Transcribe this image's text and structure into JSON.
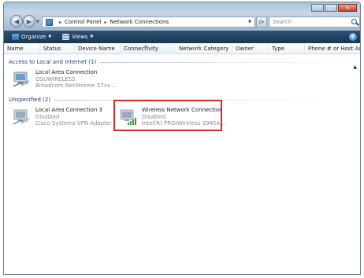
{
  "address": {
    "segments": [
      "Control Panel",
      "Network Connections"
    ],
    "separator": "▸"
  },
  "search": {
    "placeholder": "Search"
  },
  "toolbar": {
    "organize_label": "Organize",
    "views_label": "Views"
  },
  "columns": [
    "Name",
    "Status",
    "Device Name",
    "Connectivity",
    "Network Category",
    "Owner",
    "Type",
    "Phone # or Host Addre..."
  ],
  "groups": [
    {
      "label": "Access to Local and Internet (1)",
      "items": [
        {
          "title": "Local Area Connection",
          "status": "OSUWIRELESS",
          "device": "Broadcom NetXtreme 57xx ..."
        }
      ]
    },
    {
      "label": "Unspecified (2)",
      "items": [
        {
          "title": "Local Area Connection 3",
          "status": "Disabled",
          "device": "Cisco Systems VPN Adapter"
        },
        {
          "title": "Wireless Network Connection",
          "status": "Disabled",
          "device": "Intel(R) PRO/Wireless 3945A..."
        }
      ]
    }
  ],
  "icons": {
    "back": "back-arrow-icon",
    "forward": "forward-arrow-icon",
    "refresh": "refresh-icon",
    "search": "search-icon",
    "help": "help-icon",
    "network": "network-adapter-icon",
    "wireless": "wireless-signal-icon"
  },
  "colors": {
    "toolbar": "#23435f",
    "group_header": "#1e3d7a",
    "highlight": "#d52a2a"
  }
}
